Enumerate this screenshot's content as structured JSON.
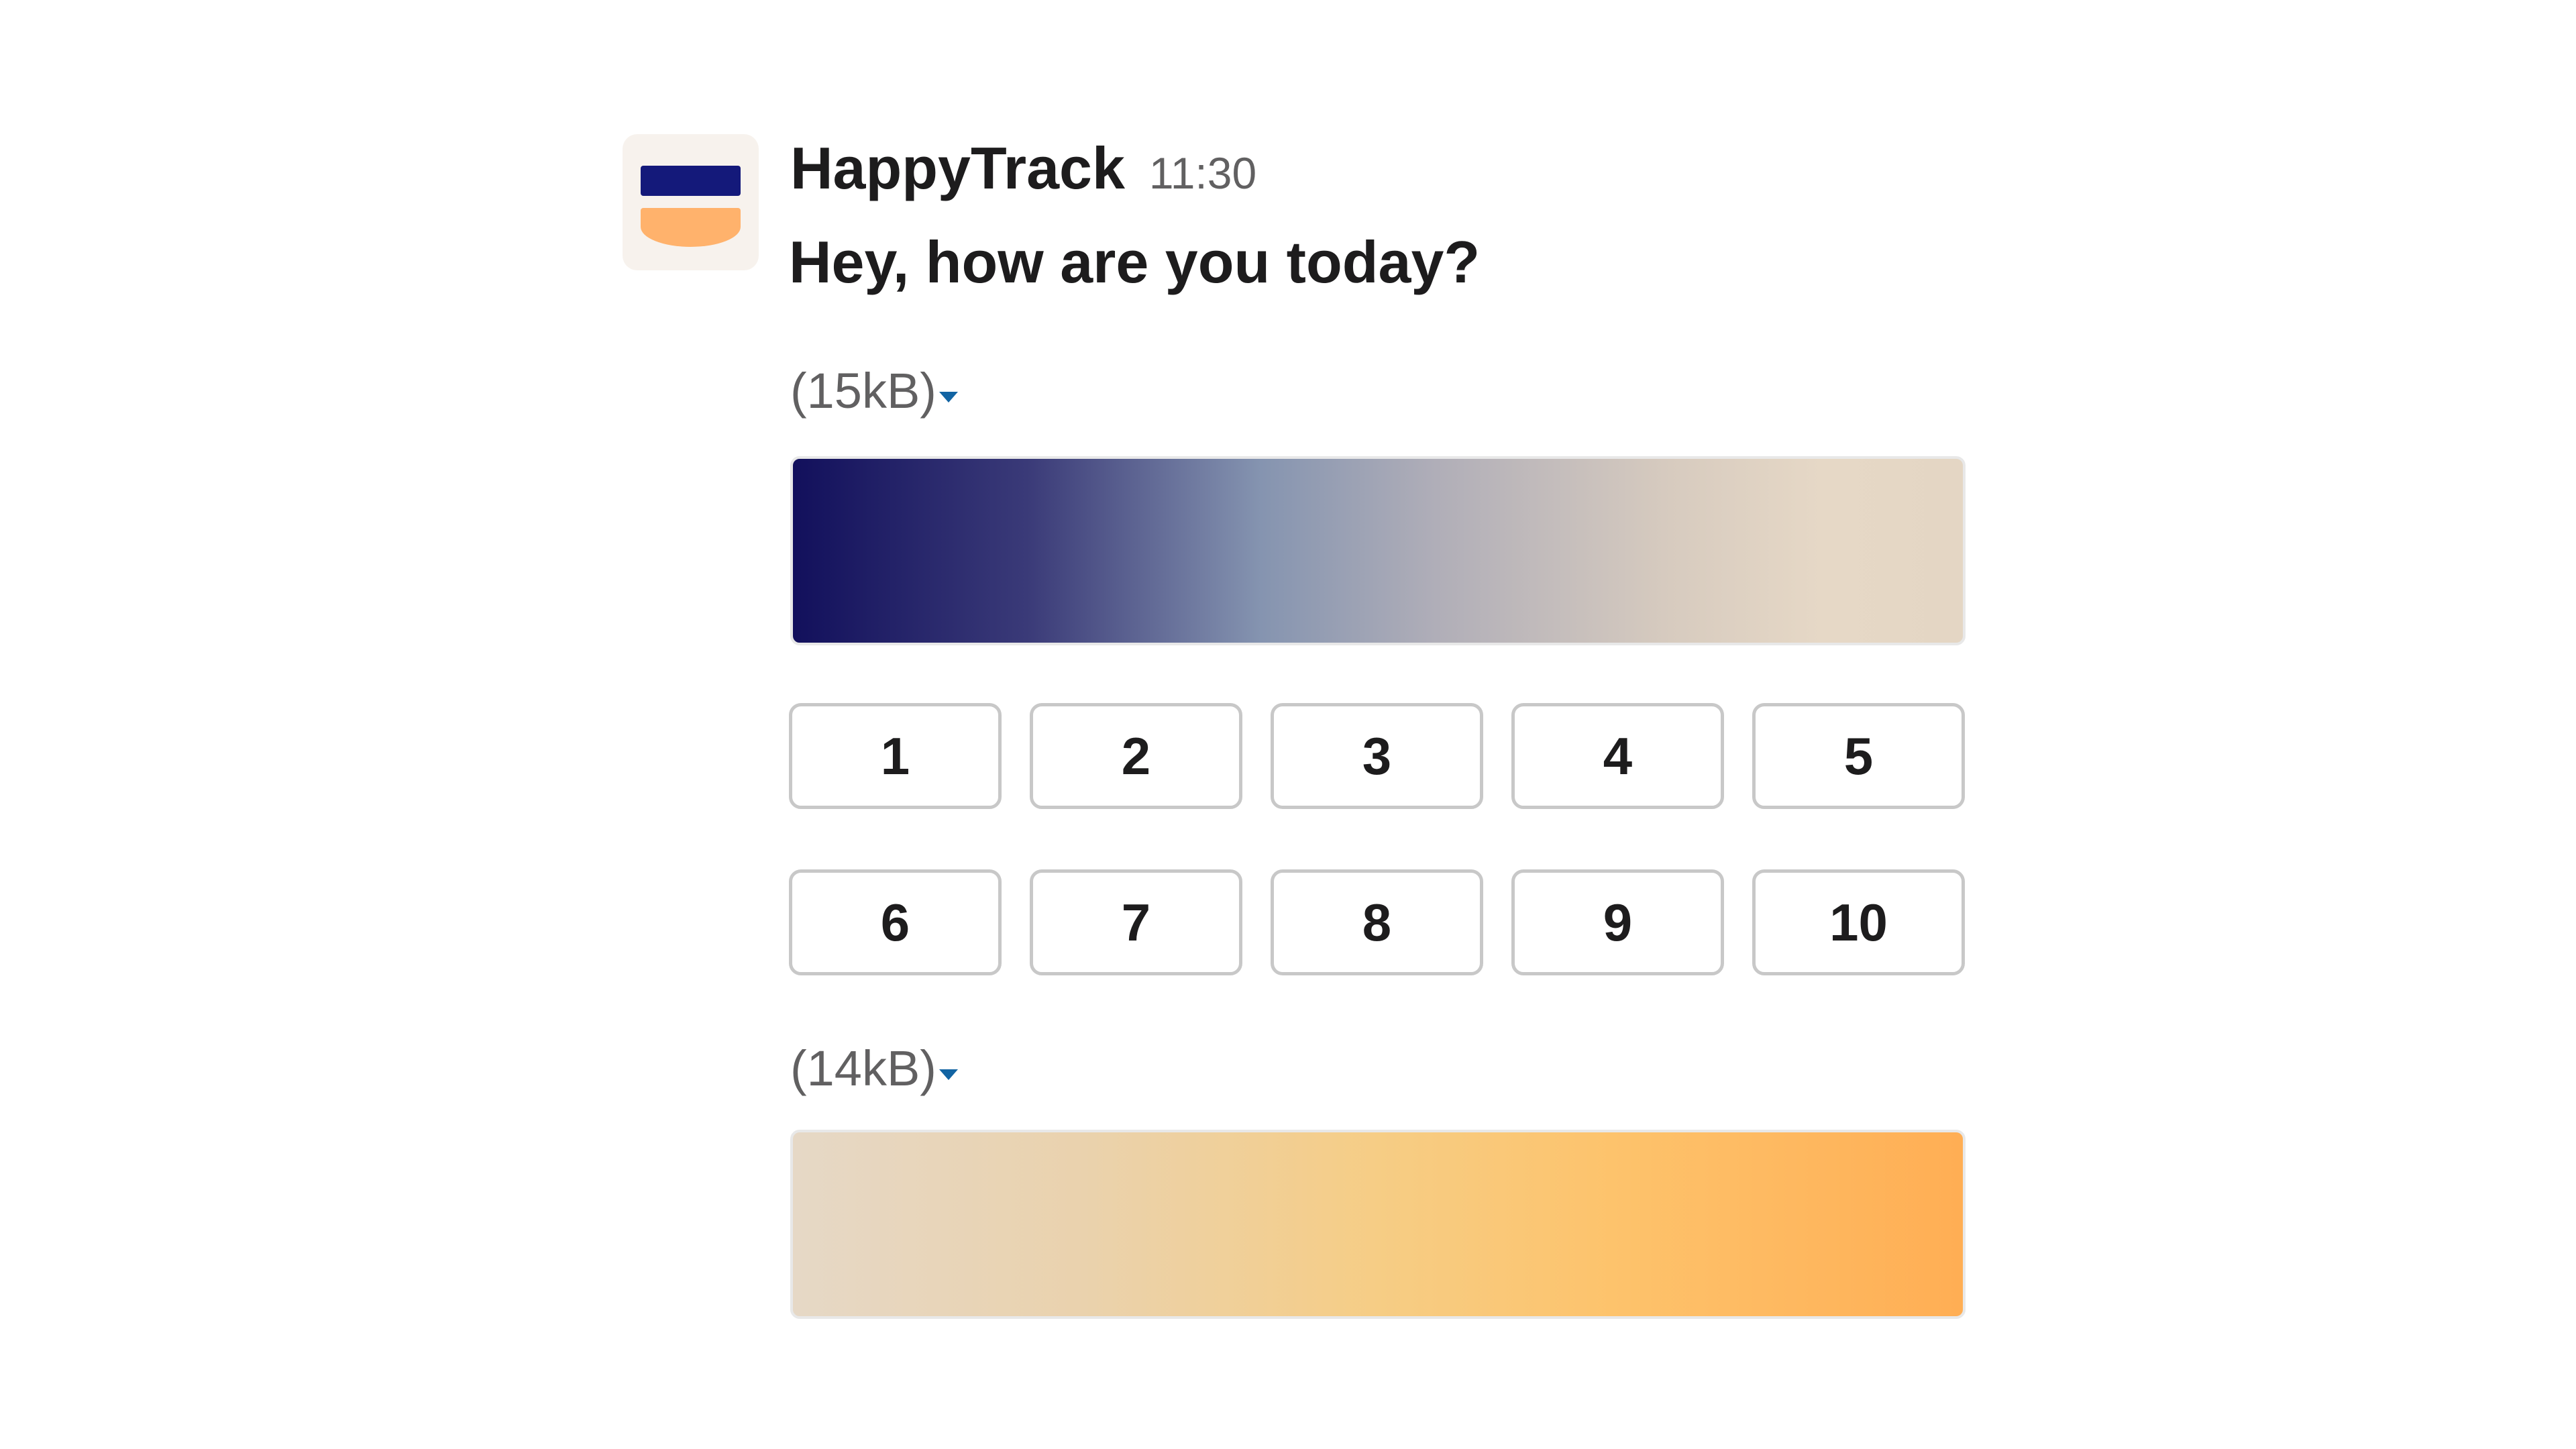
{
  "message": {
    "sender": "HappyTrack",
    "time": "11:30",
    "text": "Hey, how are you today?"
  },
  "attachments": [
    {
      "size": "(15kB)",
      "icon": "caret-down-icon",
      "colors": [
        "#12105c",
        "#8594b0",
        "#e4d6c4"
      ]
    },
    {
      "size": "(14kB)",
      "icon": "caret-down-icon",
      "colors": [
        "#e6d8c6",
        "#f6cd85",
        "#ffae54"
      ]
    }
  ],
  "rating": {
    "buttons": [
      "1",
      "2",
      "3",
      "4",
      "5",
      "6",
      "7",
      "8",
      "9",
      "10"
    ]
  },
  "colors": {
    "brand_navy": "#14197a",
    "brand_orange": "#ffb26c",
    "caret_blue": "#1264a3"
  }
}
